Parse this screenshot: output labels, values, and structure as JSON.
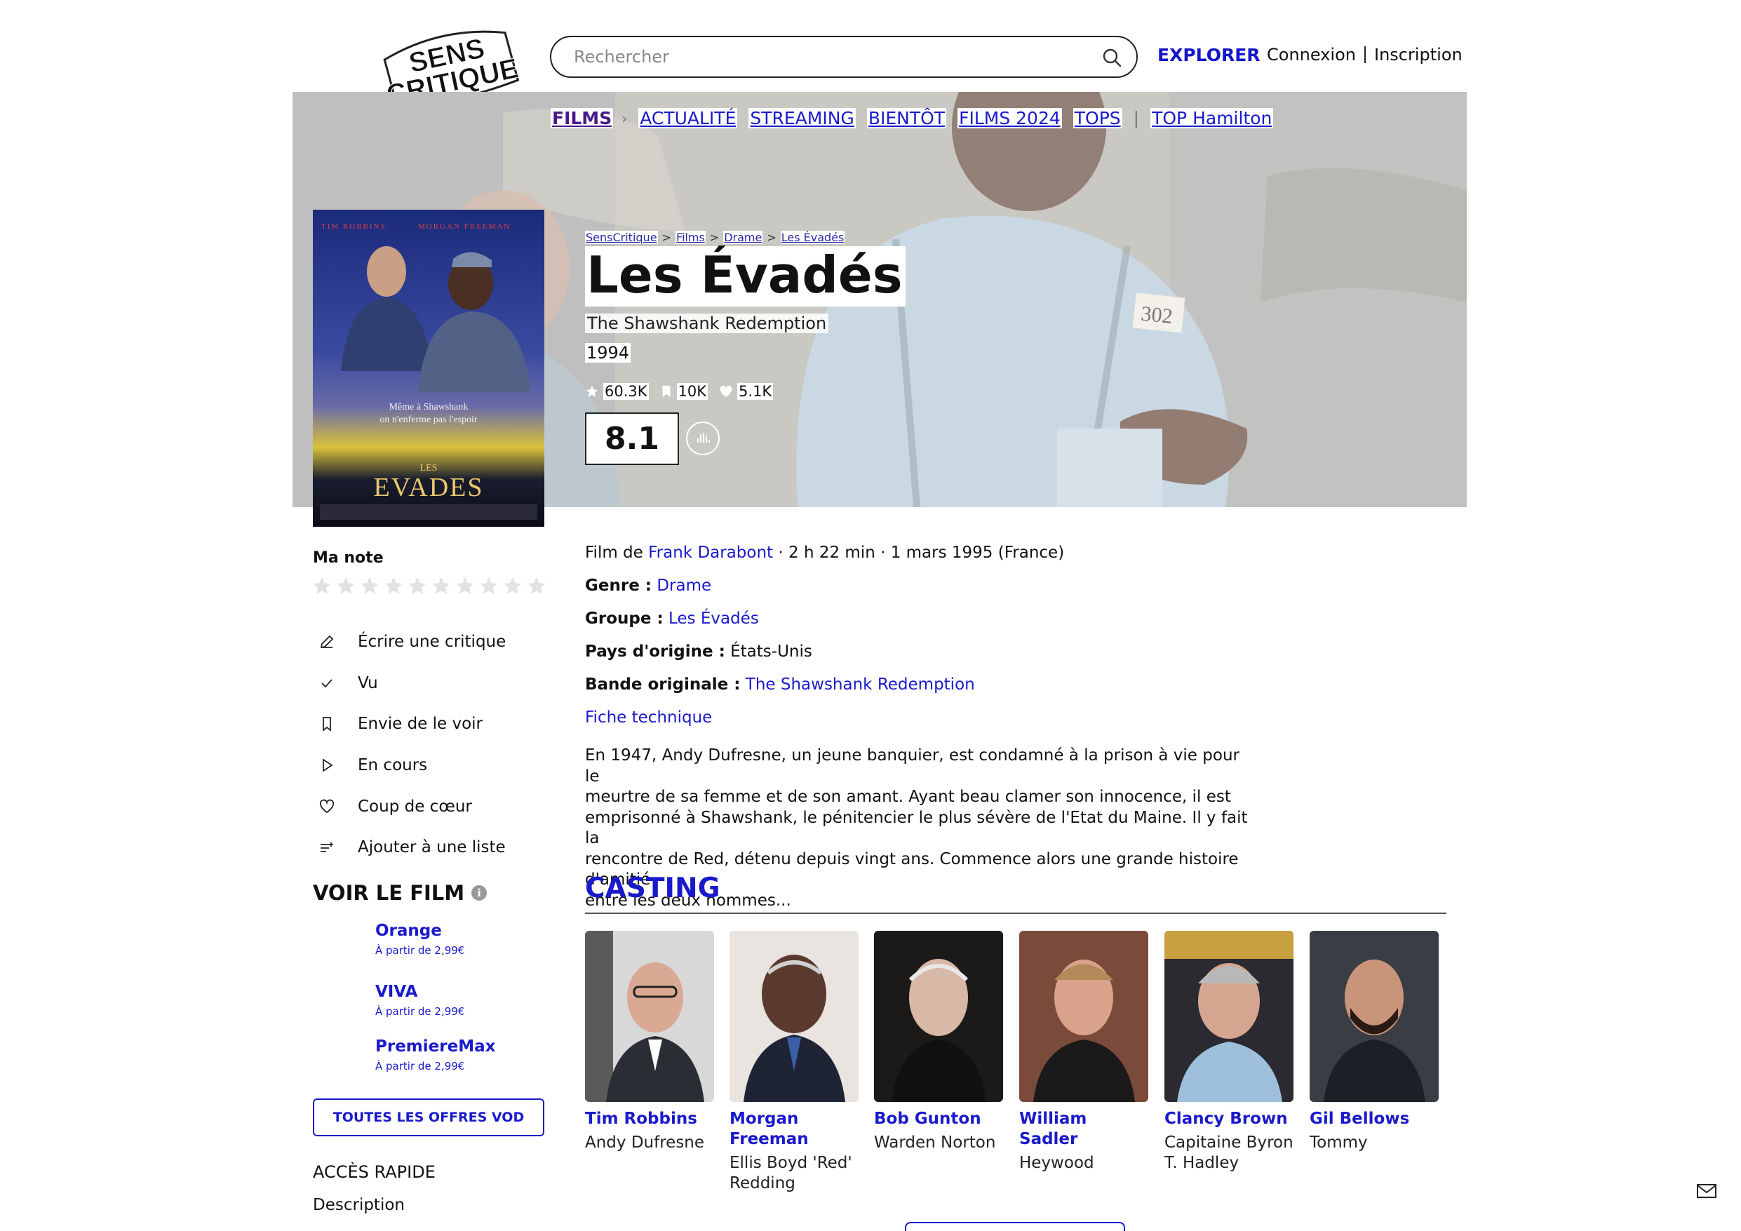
{
  "header": {
    "logo_text": [
      "SENS",
      "CRITIQUE"
    ],
    "search_placeholder": "Rechercher",
    "explorer": "EXPLORER",
    "login": "Connexion",
    "signup": "Inscription"
  },
  "nav": {
    "items": [
      "FILMS",
      "ACTUALITÉ",
      "STREAMING",
      "BIENTÔT",
      "FILMS 2024",
      "TOPS",
      "TOP Hamilton"
    ]
  },
  "breadcrumb": [
    "SensCritique",
    "Films",
    "Drame",
    "Les Évadés"
  ],
  "movie": {
    "title": "Les Évadés",
    "original_title": "The Shawshank Redemption",
    "year": "1994",
    "stats": {
      "ratings": "60.3K",
      "wishlist": "10K",
      "favorites": "5.1K"
    },
    "score": "8.1",
    "poster": {
      "actors_top": [
        "TIM ROBBINS",
        "MORGAN FREEMAN"
      ],
      "tagline": [
        "Même à Shawshank",
        "on n'enferme pas l'espoir"
      ],
      "title_small": "LES",
      "title_big": "EVADES"
    },
    "meta": {
      "prefix": "Film de",
      "director": "Frank Darabont",
      "details": "· 2 h 22 min · 1 mars 1995 (France)"
    },
    "genre": {
      "label": "Genre :",
      "value": "Drame"
    },
    "group": {
      "label": "Groupe :",
      "value": "Les Évadés"
    },
    "country": {
      "label": "Pays d'origine :",
      "value": "États-Unis"
    },
    "soundtrack": {
      "label": "Bande originale :",
      "value": "The Shawshank Redemption"
    },
    "fiche": "Fiche technique",
    "synopsis_lines": [
      "En 1947, Andy Dufresne, un jeune banquier, est condamné à la prison à vie pour le",
      "meurtre de sa femme et de son amant. Ayant beau clamer son innocence, il est",
      "emprisonné à Shawshank, le pénitencier le plus sévère de l'Etat du Maine. Il y fait la",
      "rencontre de Red, détenu depuis vingt ans. Commence alors une grande histoire d'amitié",
      "entre les deux hommes..."
    ]
  },
  "sidebar": {
    "my_rating": "Ma note",
    "actions": [
      "Écrire une critique",
      "Vu",
      "Envie de le voir",
      "En cours",
      "Coup de cœur",
      "Ajouter à une liste"
    ],
    "watch_title": "VOIR LE FILM",
    "info_glyph": "i",
    "offers": [
      {
        "name": "Orange",
        "price": "À partir de 2,99€"
      },
      {
        "name": "VIVA",
        "price": "À partir de 2,99€"
      },
      {
        "name": "PremiereMax",
        "price": "À partir de 2,99€"
      }
    ],
    "all_offers": "TOUTES LES OFFRES VOD",
    "quick_access": "ACCÈS RAPIDE",
    "description": "Description"
  },
  "casting": {
    "title": "CASTING",
    "cast": [
      {
        "name": [
          "Tim Robbins"
        ],
        "role": [
          "Andy Dufresne"
        ]
      },
      {
        "name": [
          "Morgan",
          "Freeman"
        ],
        "role": [
          "Ellis Boyd 'Red'",
          "Redding"
        ]
      },
      {
        "name": [
          "Bob Gunton"
        ],
        "role": [
          "Warden Norton"
        ]
      },
      {
        "name": [
          "William Sadler"
        ],
        "role": [
          "Heywood"
        ]
      },
      {
        "name": [
          "Clancy Brown"
        ],
        "role": [
          "Capitaine Byron",
          "T. Hadley"
        ]
      },
      {
        "name": [
          "Gil Bellows"
        ],
        "role": [
          "Tommy"
        ]
      }
    ]
  },
  "colors": {
    "accent": "#1a1acb",
    "films_nav": "#4a1a8c"
  }
}
